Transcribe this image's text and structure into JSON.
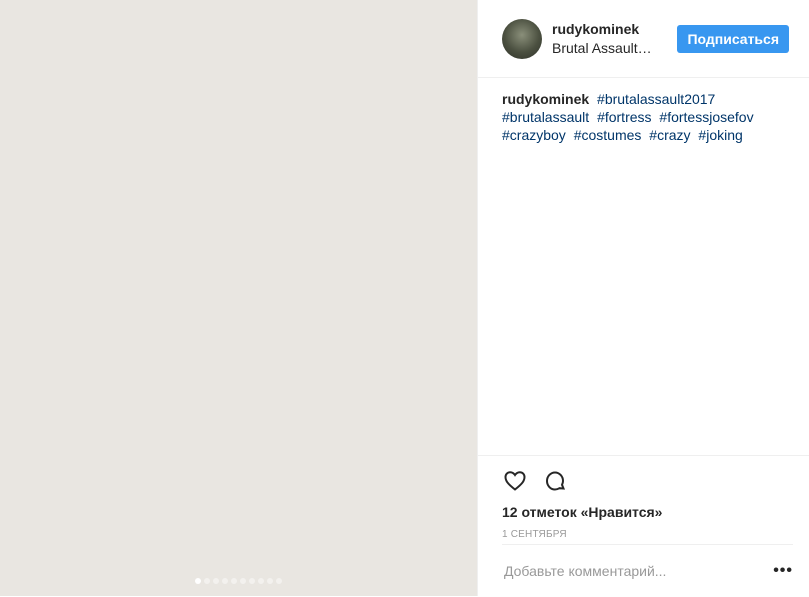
{
  "post": {
    "media": {
      "placeholder": "",
      "dots_count": 10,
      "active_dot": 0
    },
    "header": {
      "username": "rudykominek",
      "location": "Brutal Assault…",
      "follow_label": "Подписаться"
    },
    "caption": {
      "username": "rudykominek",
      "hashtags": [
        "#brutalassault2017",
        "#brutalassault",
        "#fortress",
        "#fortessjosefov",
        "#crazyboy",
        "#costumes",
        "#crazy",
        "#joking"
      ]
    },
    "actions": {
      "like_icon": "heart-icon",
      "comment_icon": "comment-bubble-icon"
    },
    "likes_text": "12 отметок «Нравится»",
    "date_text": "1 сентября",
    "comment": {
      "placeholder": "Добавьте комментарий...",
      "more_label": "•••"
    },
    "colors": {
      "follow_button": "#3897f0",
      "hashtag": "#003569",
      "muted": "#999999",
      "divider": "#efefef"
    }
  }
}
